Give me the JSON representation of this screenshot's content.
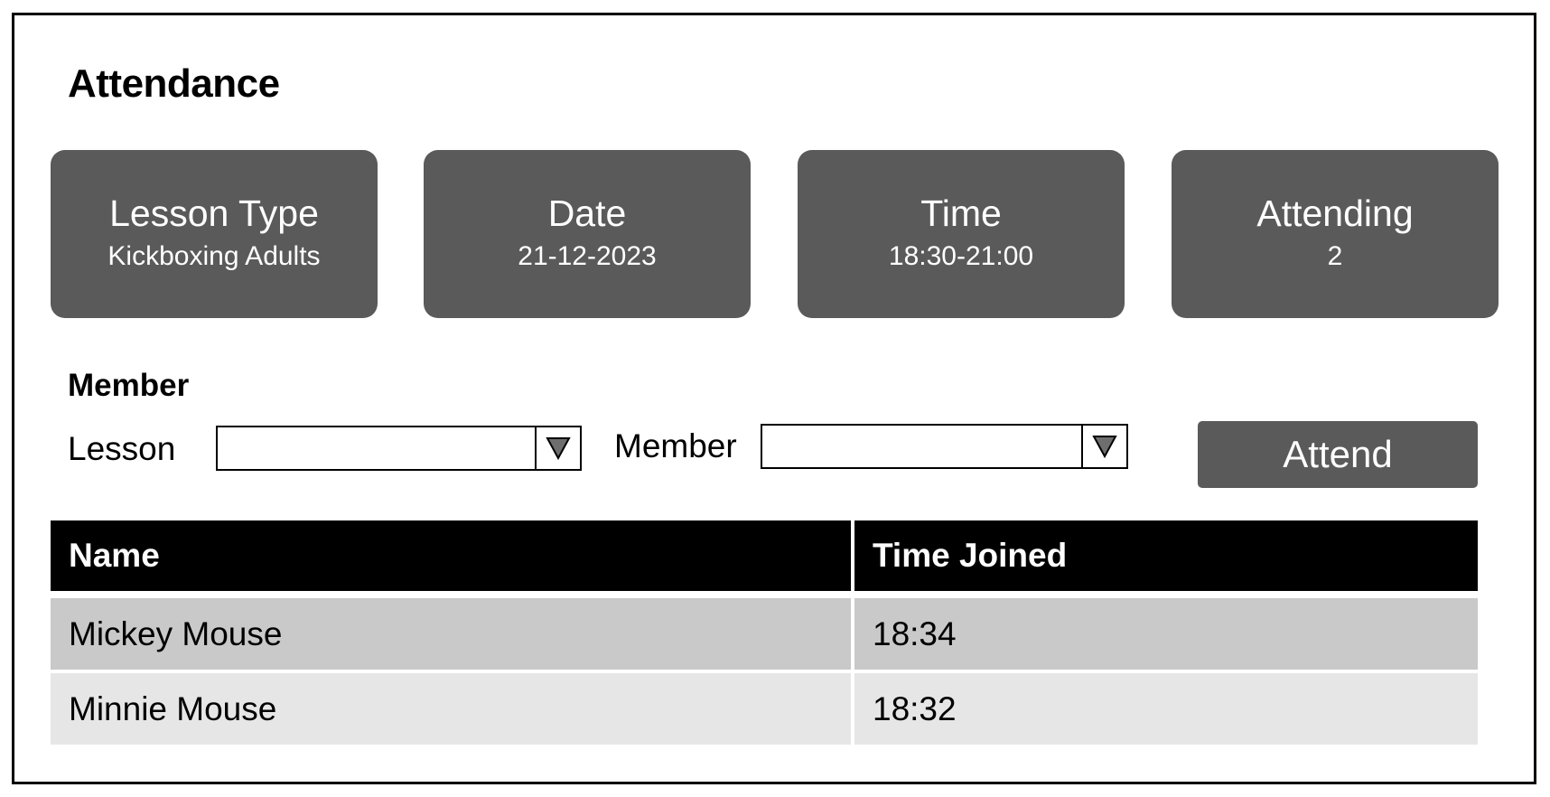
{
  "page": {
    "title": "Attendance"
  },
  "cards": [
    {
      "label": "Lesson Type",
      "value": "Kickboxing Adults"
    },
    {
      "label": "Date",
      "value": "21-12-2023"
    },
    {
      "label": "Time",
      "value": "18:30-21:00"
    },
    {
      "label": "Attending",
      "value": "2"
    }
  ],
  "member_section": {
    "title": "Member",
    "lesson_label": "Lesson",
    "lesson_value": "",
    "member_label": "Member",
    "member_value": "",
    "attend_label": "Attend"
  },
  "table": {
    "columns": [
      "Name",
      "Time Joined"
    ],
    "rows": [
      {
        "name": "Mickey Mouse",
        "time_joined": "18:34"
      },
      {
        "name": "Minnie Mouse",
        "time_joined": "18:32"
      }
    ]
  },
  "colors": {
    "card_bg": "#5a5a5a",
    "header_bg": "#000000",
    "row_odd": "#c9c9c9",
    "row_even": "#e6e6e6"
  },
  "icons": {
    "dropdown": "triangle-down-icon"
  }
}
